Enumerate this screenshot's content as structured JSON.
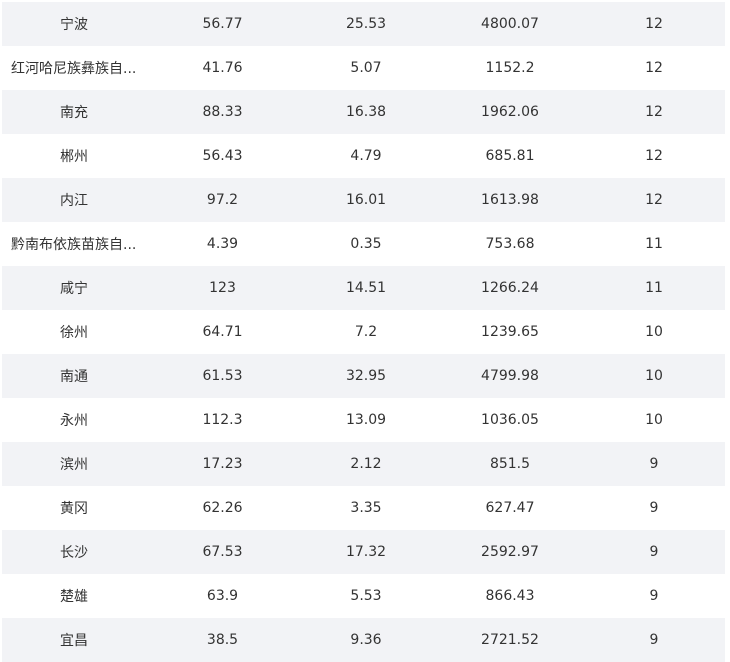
{
  "table": {
    "rows": [
      {
        "city": "宁波",
        "v1": "56.77",
        "v2": "25.53",
        "v3": "4800.07",
        "v4": "12"
      },
      {
        "city": "红河哈尼族彝族自...",
        "v1": "41.76",
        "v2": "5.07",
        "v3": "1152.2",
        "v4": "12"
      },
      {
        "city": "南充",
        "v1": "88.33",
        "v2": "16.38",
        "v3": "1962.06",
        "v4": "12"
      },
      {
        "city": "郴州",
        "v1": "56.43",
        "v2": "4.79",
        "v3": "685.81",
        "v4": "12"
      },
      {
        "city": "内江",
        "v1": "97.2",
        "v2": "16.01",
        "v3": "1613.98",
        "v4": "12"
      },
      {
        "city": "黔南布依族苗族自...",
        "v1": "4.39",
        "v2": "0.35",
        "v3": "753.68",
        "v4": "11"
      },
      {
        "city": "咸宁",
        "v1": "123",
        "v2": "14.51",
        "v3": "1266.24",
        "v4": "11"
      },
      {
        "city": "徐州",
        "v1": "64.71",
        "v2": "7.2",
        "v3": "1239.65",
        "v4": "10"
      },
      {
        "city": "南通",
        "v1": "61.53",
        "v2": "32.95",
        "v3": "4799.98",
        "v4": "10"
      },
      {
        "city": "永州",
        "v1": "112.3",
        "v2": "13.09",
        "v3": "1036.05",
        "v4": "10"
      },
      {
        "city": "滨州",
        "v1": "17.23",
        "v2": "2.12",
        "v3": "851.5",
        "v4": "9"
      },
      {
        "city": "黄冈",
        "v1": "62.26",
        "v2": "3.35",
        "v3": "627.47",
        "v4": "9"
      },
      {
        "city": "长沙",
        "v1": "67.53",
        "v2": "17.32",
        "v3": "2592.97",
        "v4": "9"
      },
      {
        "city": "楚雄",
        "v1": "63.9",
        "v2": "5.53",
        "v3": "866.43",
        "v4": "9"
      },
      {
        "city": "宜昌",
        "v1": "38.5",
        "v2": "9.36",
        "v3": "2721.52",
        "v4": "9"
      }
    ]
  }
}
